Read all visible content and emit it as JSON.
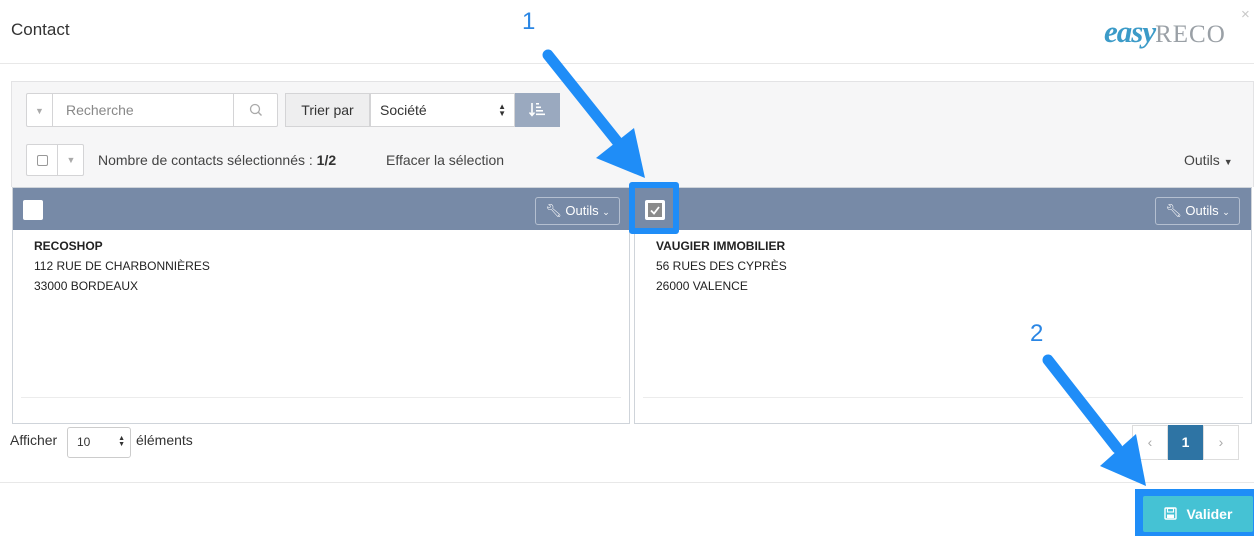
{
  "header": {
    "title": "Contact",
    "logo_part1": "easy",
    "logo_part2": "RECO",
    "close": "×"
  },
  "toolbar": {
    "search_placeholder": "Recherche",
    "sort_label": "Trier par",
    "sort_value": "Société",
    "selection_text": "Nombre de contacts sélectionnés : ",
    "selection_count": "1/2",
    "clear_selection": "Effacer la sélection",
    "tools_label": "Outils"
  },
  "cards": [
    {
      "checked": false,
      "tools_label": "Outils",
      "name": "RECOSHOP",
      "address": "112 RUE DE CHARBONNIÈRES",
      "city": "33000 BORDEAUX"
    },
    {
      "checked": true,
      "tools_label": "Outils",
      "name": "VAUGIER IMMOBILIER",
      "address": "56 RUES DES CYPRÈS",
      "city": "26000 VALENCE"
    }
  ],
  "footer": {
    "show_label": "Afficher",
    "per_page": "10",
    "elements_label": "éléments",
    "current_page": "1",
    "prev": "‹",
    "next": "›",
    "validate_label": "Valider"
  },
  "annotations": {
    "step1": "1",
    "step2": "2",
    "color": "#1f8df7"
  },
  "colors": {
    "card_header": "#778aa7",
    "validate_button": "#45c2d4",
    "pagination_active": "#2e74a4",
    "logo_blue": "#3c9bc8"
  }
}
